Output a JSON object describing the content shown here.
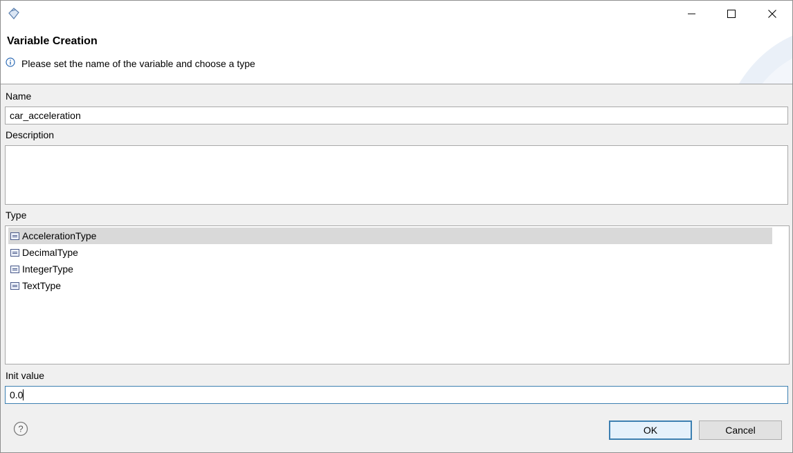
{
  "window": {
    "icon": "diamond-app-icon",
    "controls": [
      "minimize-icon",
      "maximize-icon",
      "close-icon"
    ]
  },
  "banner": {
    "title": "Variable Creation",
    "message": "Please set the name of the variable and choose a type",
    "message_icon": "info-icon"
  },
  "form": {
    "name_label": "Name",
    "name_value": "car_acceleration",
    "description_label": "Description",
    "description_value": "",
    "type_label": "Type",
    "types": [
      {
        "label": "AccelerationType",
        "selected": true
      },
      {
        "label": "DecimalType",
        "selected": false
      },
      {
        "label": "IntegerType",
        "selected": false
      },
      {
        "label": "TextType",
        "selected": false
      }
    ],
    "init_label": "Init value",
    "init_value": "0.0"
  },
  "footer": {
    "help_icon": "help-icon",
    "ok_label": "OK",
    "cancel_label": "Cancel"
  },
  "colors": {
    "accent": "#3c7fb1",
    "selection": "#d9d9d9"
  }
}
